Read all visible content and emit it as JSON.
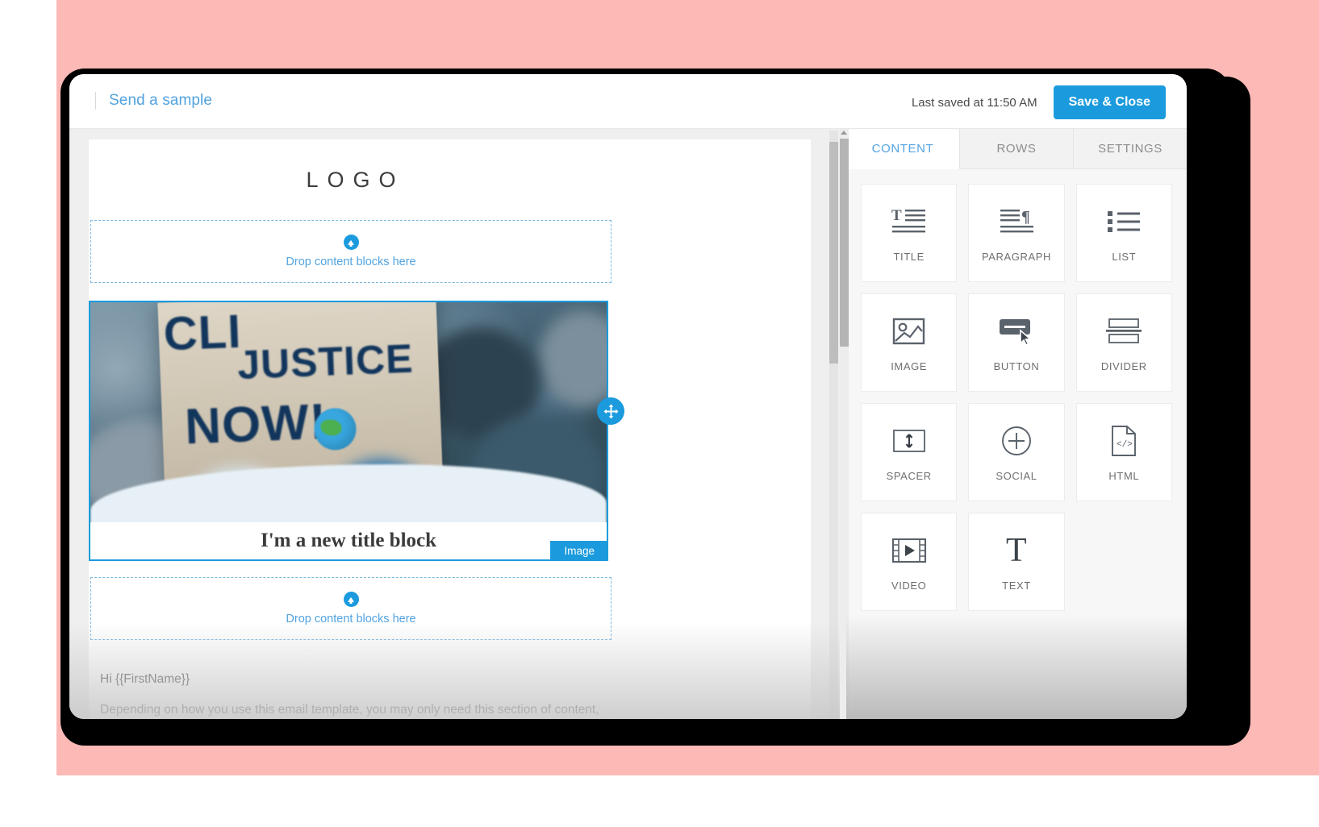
{
  "window": {
    "topbar": {
      "send_sample_label": "Send a sample",
      "last_saved": "Last saved at 11:50 AM",
      "save_close_label": "Save & Close"
    }
  },
  "canvas": {
    "logo_text": "LOGO",
    "dropzone_top_label": "Drop content blocks here",
    "dropzone_bottom_label": "Drop content blocks here",
    "image_block": {
      "badge_label": "Image",
      "sign_line1": "CLI",
      "sign_line2": "JUSTICE",
      "sign_line3": "NOW!"
    },
    "title_block_text": "I'm a new title block",
    "letter": {
      "greeting": "Hi {{FirstName}}",
      "paragraph": "Depending on how you use this email template, you may only need this section of content, and you may keep the button below for your action. Keep paragraphs short and"
    }
  },
  "side_panel": {
    "tabs": [
      {
        "label": "CONTENT",
        "active": true
      },
      {
        "label": "ROWS",
        "active": false
      },
      {
        "label": "SETTINGS",
        "active": false
      }
    ],
    "blocks": [
      {
        "label": "TITLE",
        "icon": "title-icon"
      },
      {
        "label": "PARAGRAPH",
        "icon": "paragraph-icon"
      },
      {
        "label": "LIST",
        "icon": "list-icon"
      },
      {
        "label": "IMAGE",
        "icon": "image-icon"
      },
      {
        "label": "BUTTON",
        "icon": "button-icon"
      },
      {
        "label": "DIVIDER",
        "icon": "divider-icon"
      },
      {
        "label": "SPACER",
        "icon": "spacer-icon"
      },
      {
        "label": "SOCIAL",
        "icon": "social-icon"
      },
      {
        "label": "HTML",
        "icon": "html-icon"
      },
      {
        "label": "VIDEO",
        "icon": "video-icon"
      },
      {
        "label": "TEXT",
        "icon": "text-icon"
      }
    ]
  },
  "colors": {
    "accent_blue": "#1b9bdd",
    "link_blue": "#52a3e0",
    "backdrop_pink": "#fcb9b5",
    "bezel_black": "#000000"
  }
}
